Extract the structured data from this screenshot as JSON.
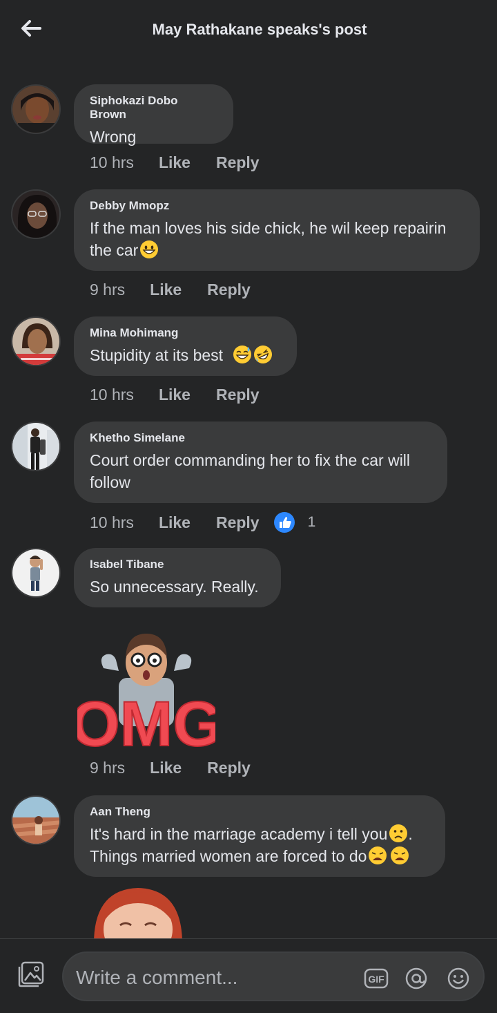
{
  "header": {
    "title": "May Rathakane speaks's post"
  },
  "comments": [
    {
      "author": "Siphokazi Dobo Brown",
      "text": "Wrong",
      "time": "10 hrs",
      "like": "Like",
      "reply": "Reply"
    },
    {
      "author": "Debby Mmopz",
      "text": "If the man loves his side chick, he wil keep repairin the car",
      "time": "9 hrs",
      "like": "Like",
      "reply": "Reply"
    },
    {
      "author": "Mina Mohimang",
      "text": "Stupidity at its best",
      "time": "10 hrs",
      "like": "Like",
      "reply": "Reply"
    },
    {
      "author": "Khetho Simelane",
      "text": "Court order commanding her to fix the car will follow",
      "time": "10 hrs",
      "like": "Like",
      "reply": "Reply",
      "reaction_count": "1"
    },
    {
      "author": "Isabel Tibane",
      "text": "So unnecessary. Really.",
      "time": "9 hrs",
      "like": "Like",
      "reply": "Reply",
      "sticker_text": "OMG"
    },
    {
      "author": "Aan Theng",
      "text_line1": "It's hard in the marriage academy i tell you",
      "text_line1_end": ".",
      "text_line2": "Things married women are forced to do"
    }
  ],
  "composer": {
    "placeholder": "Write a comment...",
    "gif_label": "GIF"
  },
  "colors": {
    "background": "#242526",
    "bubble": "#3a3b3c",
    "text": "#e4e6eb",
    "muted": "#b0b3b8",
    "like_blue": "#2d88ff",
    "omg_red": "#f04a52"
  }
}
